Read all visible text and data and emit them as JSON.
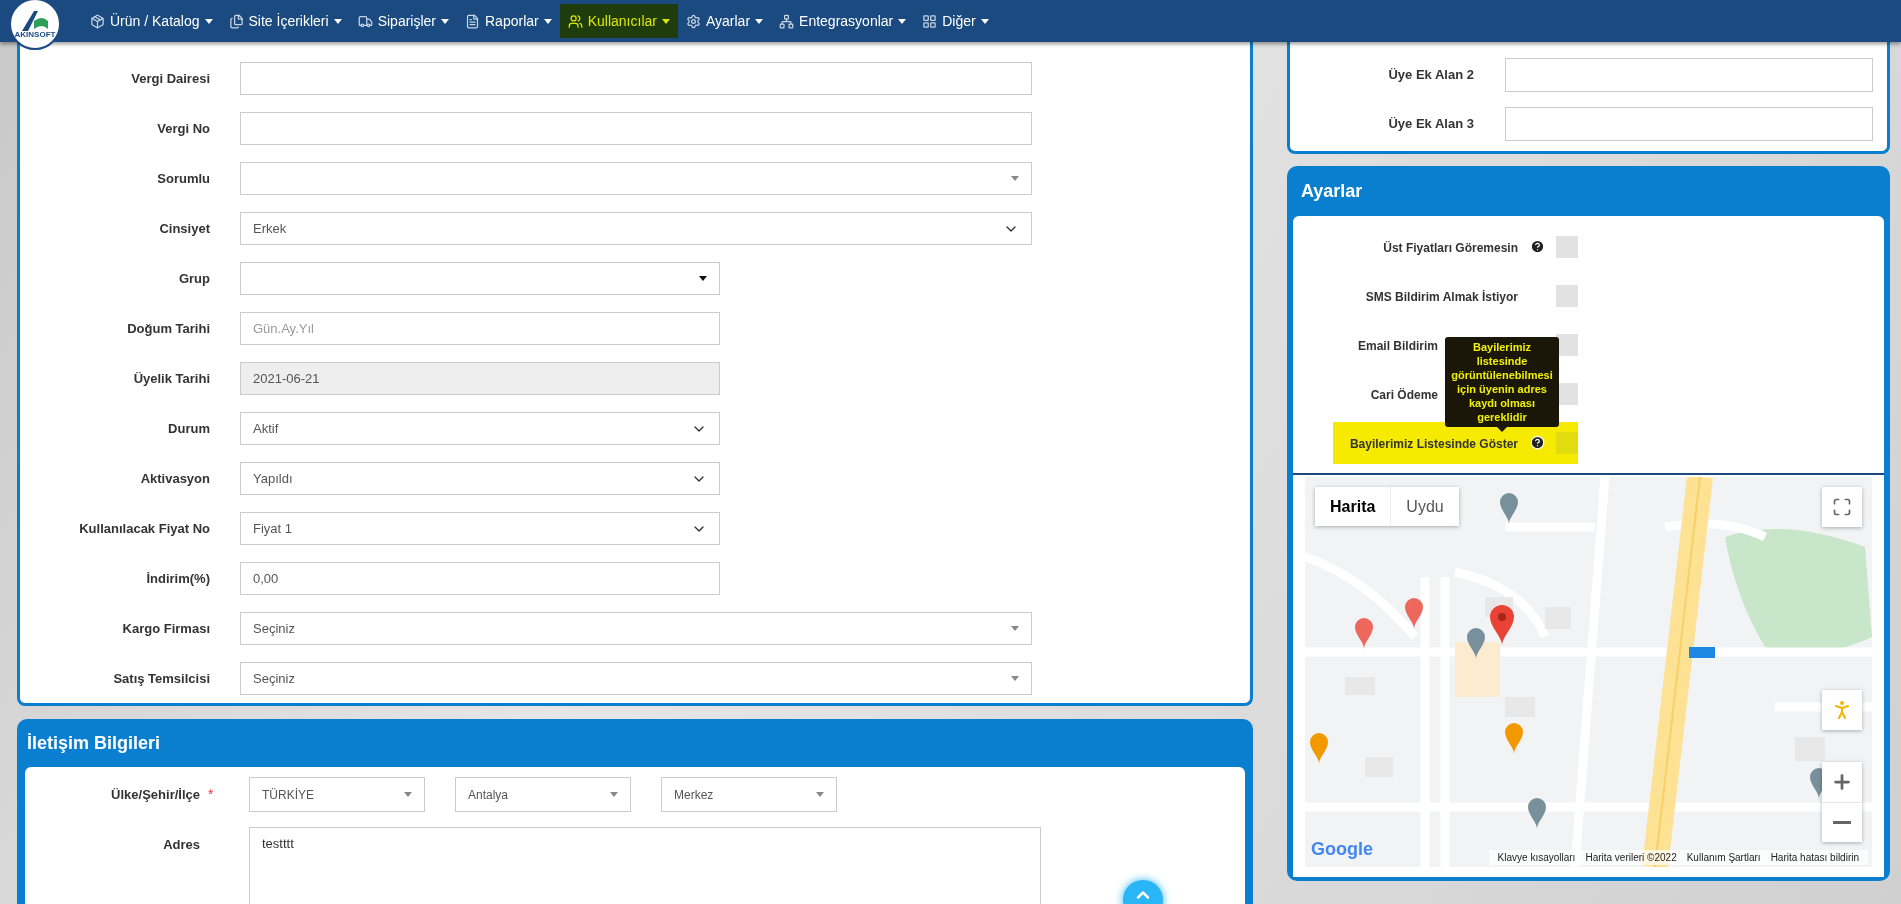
{
  "logo": {
    "text": "AKINSOFT"
  },
  "nav": [
    {
      "label": "Ürün / Katalog",
      "selected": false
    },
    {
      "label": "Site İçerikleri",
      "selected": false
    },
    {
      "label": "Siparişler",
      "selected": false
    },
    {
      "label": "Raporlar",
      "selected": false
    },
    {
      "label": "Kullanıcılar",
      "selected": true
    },
    {
      "label": "Ayarlar",
      "selected": false
    },
    {
      "label": "Entegrasyonlar",
      "selected": false
    },
    {
      "label": "Diğer",
      "selected": false
    }
  ],
  "member_form": {
    "fields": [
      {
        "label": "Vergi Dairesi",
        "kind": "text"
      },
      {
        "label": "Vergi No",
        "kind": "text"
      },
      {
        "label": "Sorumlu",
        "kind": "combo"
      },
      {
        "label": "Cinsiyet",
        "kind": "select",
        "value": "Erkek"
      },
      {
        "label": "Grup",
        "kind": "dropdown"
      },
      {
        "label": "Doğum Tarihi",
        "kind": "text",
        "placeholder": "Gün.Ay.Yıl"
      },
      {
        "label": "Üyelik Tarihi",
        "kind": "readonly",
        "value": "2021-06-21"
      },
      {
        "label": "Durum",
        "kind": "select",
        "value": "Aktif"
      },
      {
        "label": "Aktivasyon",
        "kind": "select",
        "value": "Yapıldı"
      },
      {
        "label": "Kullanılacak Fiyat No",
        "kind": "select",
        "value": "Fiyat 1"
      },
      {
        "label": "İndirim(%)",
        "kind": "text",
        "value": "0,00"
      },
      {
        "label": "Kargo Firması",
        "kind": "combo",
        "value": "Seçiniz"
      },
      {
        "label": "Satış Temsilcisi",
        "kind": "combo",
        "value": "Seçiniz"
      }
    ]
  },
  "contact": {
    "title": "İletişim Bilgileri",
    "location": {
      "label": "Ülke/Şehir/İlçe",
      "required_mark": "*",
      "selects": [
        "TÜRKİYE",
        "Antalya",
        "Merkez"
      ]
    },
    "address": {
      "label": "Adres",
      "value": "testttt"
    }
  },
  "extra_fields": [
    {
      "label": "Üye Ek Alan 2"
    },
    {
      "label": "Üye Ek Alan 3"
    }
  ],
  "settings": {
    "title": "Ayarlar",
    "options": [
      {
        "label": "Üst Fiyatları Göremesin",
        "help": true,
        "checked": false,
        "highlighted": false,
        "cut": false
      },
      {
        "label": "SMS Bildirim Almak İstiyor",
        "help": false,
        "checked": false,
        "highlighted": false,
        "cut": false
      },
      {
        "label": "Email Bildirim",
        "help": false,
        "checked": false,
        "highlighted": false,
        "cut": true
      },
      {
        "label": "Cari Ödeme",
        "help": false,
        "checked": false,
        "highlighted": false,
        "cut": true
      },
      {
        "label": "Bayilerimiz Listesinde Göster",
        "help": true,
        "checked": false,
        "highlighted": true,
        "cut": false
      }
    ],
    "tooltip": "Bayilerimiz listesinde görüntülenebilmesi için üyenin adres kaydı olması gereklidir"
  },
  "map": {
    "types": [
      {
        "label": "Harita",
        "selected": true
      },
      {
        "label": "Uydu",
        "selected": false
      }
    ],
    "logo": "Google",
    "attribution": [
      "Klavye kısayolları",
      "Harita verileri ©2022",
      "Kullanım Şartları",
      "Harita hatası bildirin"
    ]
  }
}
